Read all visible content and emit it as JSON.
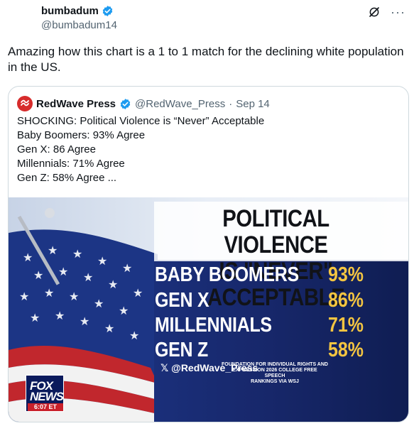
{
  "post": {
    "author_name": "bumbadum",
    "author_handle": "@bumbadum14",
    "text": "Amazing how this chart is a 1 to 1 match for the declining white population in the US."
  },
  "quote": {
    "author_name": "RedWave Press",
    "author_handle": "@RedWave_Press",
    "separator": "·",
    "date": "Sep 14",
    "lines": [
      "SHOCKING: Political Violence is “Never” Acceptable",
      "Baby Boomers: 93% Agree",
      "Gen X: 86 Agree",
      "Millennials: 71% Agree",
      "Gen Z: 58% Agree ..."
    ]
  },
  "graphic": {
    "title_line1": "POLITICAL VIOLENCE",
    "title_line2": "IS \"NEVER\" ACCEPTABLE",
    "rows": [
      {
        "label": "BABY BOOMERS",
        "value": "93%"
      },
      {
        "label": "GEN X",
        "value": "86%"
      },
      {
        "label": "MILLENNIALS",
        "value": "71%"
      },
      {
        "label": "GEN Z",
        "value": "58%"
      }
    ],
    "watermark": "𝕏 @RedWave_Press",
    "source_line1": "FOUNDATION FOR INDIVIDUAL RIGHTS AND",
    "source_line2": "EXPRESSION 2026 COLLEGE FREE SPEECH",
    "source_line3": "RANKINGS VIA WSJ",
    "network_line1": "FOX",
    "network_line2": "NEWS",
    "time": "6:07 ET"
  },
  "icons": {
    "verified": "verified-badge-icon",
    "grok": "grok-icon",
    "more": "more-icon"
  },
  "colors": {
    "verified_blue": "#1d9bf0",
    "graphic_navy": "#1b2a66",
    "percent_yellow": "#f4c541"
  }
}
